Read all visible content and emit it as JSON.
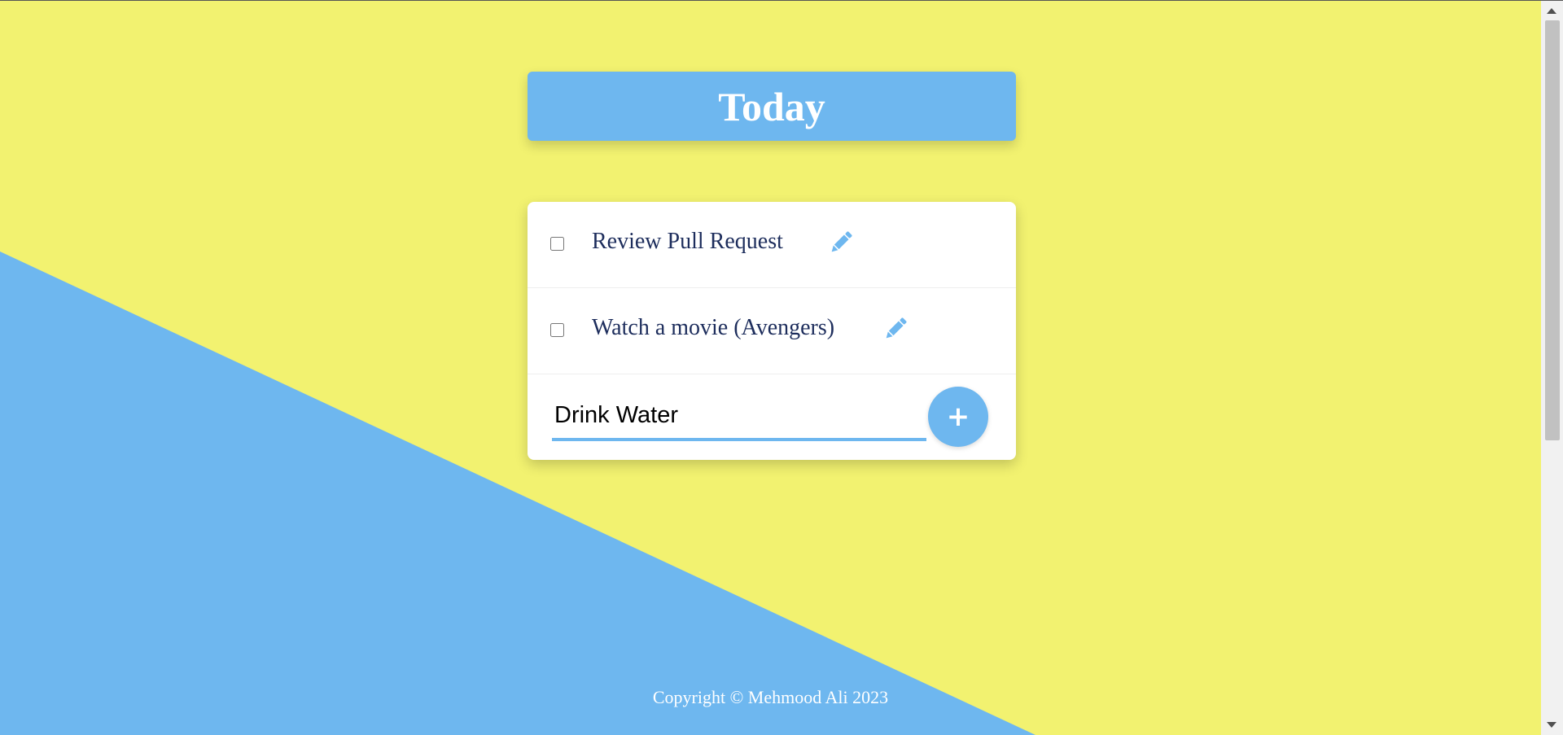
{
  "header": {
    "title": "Today"
  },
  "todos": [
    {
      "text": "Review Pull Request",
      "checked": false
    },
    {
      "text": "Watch a movie (Avengers)",
      "checked": false
    }
  ],
  "new_item": {
    "value": "Drink Water"
  },
  "add_button": {
    "label": "+"
  },
  "footer": {
    "copyright": "Copyright © Mehmood Ali 2023"
  },
  "colors": {
    "background_yellow": "#f2f270",
    "accent_blue": "#6eb7ef",
    "text_navy": "#1d2d5c",
    "white": "#ffffff"
  },
  "icons": {
    "edit": "pencil-icon",
    "add": "plus-icon"
  }
}
